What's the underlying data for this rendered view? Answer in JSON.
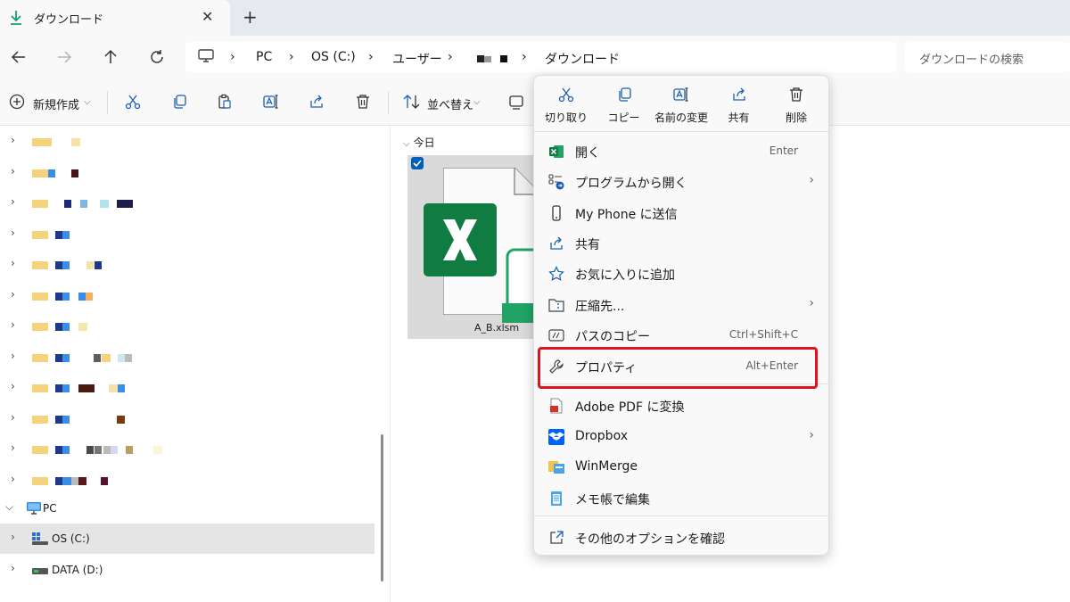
{
  "tab": {
    "title": "ダウンロード",
    "close": "✕",
    "new": "+"
  },
  "address": {
    "crumbs": [
      "PC",
      "OS (C:)",
      "ユーザー",
      "ダウンロード"
    ],
    "separator": "›"
  },
  "search": {
    "placeholder": "ダウンロードの検索"
  },
  "toolbar": {
    "new_label": "新規作成",
    "sort_label": "並べ替え"
  },
  "nav": {
    "pc_label": "PC",
    "os_label": "OS (C:)",
    "data_label": "DATA (D:)"
  },
  "content": {
    "group_header": "今日",
    "file_name": "A_B.xlsm"
  },
  "context_menu": {
    "quick_actions": [
      {
        "label": "切り取り",
        "icon": "cut-icon"
      },
      {
        "label": "コピー",
        "icon": "copy-icon"
      },
      {
        "label": "名前の変更",
        "icon": "rename-icon"
      },
      {
        "label": "共有",
        "icon": "share-icon"
      },
      {
        "label": "削除",
        "icon": "delete-icon"
      }
    ],
    "items": [
      {
        "label": "開く",
        "shortcut": "Enter",
        "icon": "excel-icon"
      },
      {
        "label": "プログラムから開く",
        "shortcut": "",
        "icon": "open-with-icon",
        "submenu": true
      },
      {
        "label": "My Phone に送信",
        "shortcut": "",
        "icon": "phone-icon"
      },
      {
        "label": "共有",
        "shortcut": "",
        "icon": "share-icon"
      },
      {
        "label": "お気に入りに追加",
        "shortcut": "",
        "icon": "star-icon"
      },
      {
        "label": "圧縮先...",
        "shortcut": "",
        "icon": "zip-icon",
        "submenu": true
      },
      {
        "label": "パスのコピー",
        "shortcut": "Ctrl+Shift+C",
        "icon": "path-copy-icon"
      },
      {
        "label": "プロパティ",
        "shortcut": "Alt+Enter",
        "icon": "wrench-icon"
      },
      {
        "label": "Adobe PDF に変換",
        "shortcut": "",
        "icon": "pdf-icon"
      },
      {
        "label": "Dropbox",
        "shortcut": "",
        "icon": "dropbox-icon",
        "submenu": true
      },
      {
        "label": "WinMerge",
        "shortcut": "",
        "icon": "winmerge-icon"
      },
      {
        "label": "メモ帳で編集",
        "shortcut": "",
        "icon": "notepad-icon"
      },
      {
        "label": "その他のオプションを確認",
        "shortcut": "",
        "icon": "more-options-icon"
      }
    ],
    "submenu_glyph": "›"
  },
  "colors": {
    "accent": "#005fb8",
    "highlight_box": "#e0121c",
    "excel_green": "#107c41"
  }
}
